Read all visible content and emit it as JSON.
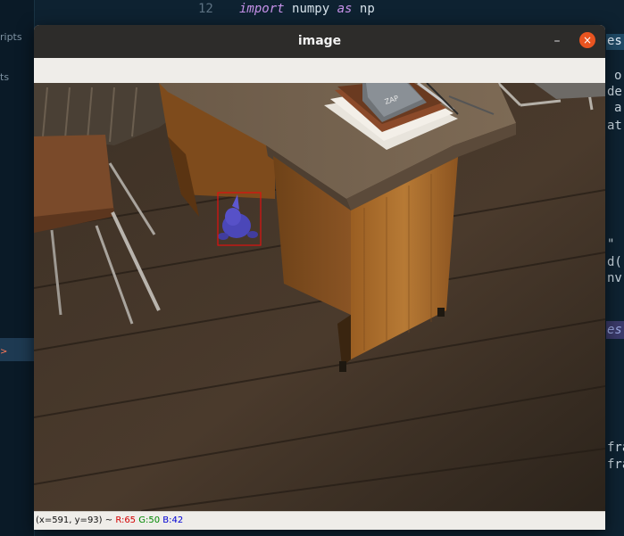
{
  "editor": {
    "sidebar_items": [
      "ripts",
      "ts"
    ],
    "line_number": "12",
    "code_keyword_import": "import",
    "code_module": "numpy",
    "code_keyword_as": "as",
    "code_alias": "np",
    "right_fragments": [
      "es",
      "o",
      "de",
      "a",
      "at",
      "\"",
      "d(",
      "nv",
      "es",
      "fra",
      "fra"
    ]
  },
  "window": {
    "title": "image",
    "minimize_glyph": "–",
    "close_glyph": "×"
  },
  "status": {
    "coords": "(x=591, y=93) ~ ",
    "r": "R:65",
    "g": "G:50",
    "b": "B:42"
  },
  "detection": {
    "box_color": "#e01010"
  }
}
